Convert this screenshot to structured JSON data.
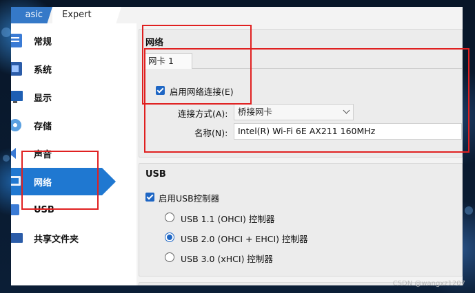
{
  "tabs": {
    "basic": "asic",
    "expert": "Expert"
  },
  "sidebar": {
    "items": [
      {
        "label": "常规",
        "icon": "general-icon"
      },
      {
        "label": "系统",
        "icon": "system-icon"
      },
      {
        "label": "显示",
        "icon": "display-icon"
      },
      {
        "label": "存储",
        "icon": "storage-icon"
      },
      {
        "label": "声音",
        "icon": "audio-icon"
      },
      {
        "label": "网络",
        "icon": "network-icon"
      },
      {
        "label": "USB",
        "icon": "usb-icon"
      },
      {
        "label": "共享文件夹",
        "icon": "shared-folder-icon"
      }
    ],
    "active": "网络"
  },
  "network": {
    "title": "网络",
    "adapter_tab": "网卡 1",
    "enable_label": "启用网络连接(E)",
    "enabled": true,
    "attached_label": "连接方式(A):",
    "attached_value": "桥接网卡",
    "name_label": "名称(N):",
    "name_value": "Intel(R) Wi-Fi 6E AX211 160MHz"
  },
  "usb": {
    "title": "USB",
    "enable_label": "启用USB控制器",
    "enabled": true,
    "options": [
      "USB 1.1 (OHCI) 控制器",
      "USB 2.0 (OHCI + EHCI) 控制器",
      "USB 3.0 (xHCI) 控制器"
    ],
    "selected_index": 1
  },
  "colors": {
    "accent": "#1f78d1",
    "highlight": "#e02020"
  },
  "watermark": "CSDN @wangxz1207"
}
